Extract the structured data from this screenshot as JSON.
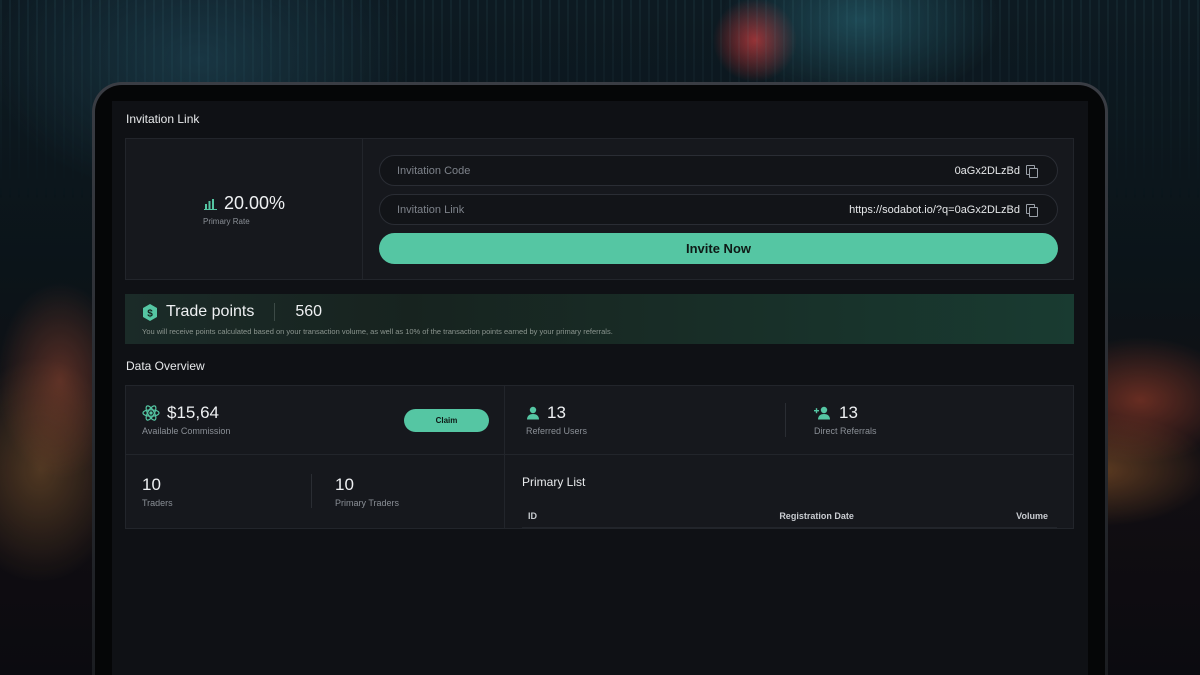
{
  "colors": {
    "accent": "#55c6a3",
    "panel": "#16181d",
    "screen": "#0f1115"
  },
  "invitation": {
    "section_title": "Invitation Link",
    "rate_icon": "bar-chart-icon",
    "rate_value": "20.00%",
    "rate_label": "Primary Rate",
    "code_label": "Invitation Code",
    "code_value": "0aGx2DLzBd",
    "link_label": "Invitation Link",
    "link_value": "https://sodabot.io/?q=0aGx2DLzBd",
    "copy_icon": "copy-icon",
    "invite_button": "Invite Now"
  },
  "trade_points": {
    "icon": "dollar-coin-icon",
    "title": "Trade points",
    "value": "560",
    "note": "You will receive points calculated based on your transaction volume, as well as 10% of the transaction points earned by your primary referrals."
  },
  "overview": {
    "section_title": "Data Overview",
    "commission": {
      "icon": "atom-icon",
      "value": "$15,64",
      "label": "Available Commission",
      "claim_button": "Claim"
    },
    "referred_users": {
      "icon": "user-icon",
      "value": "13",
      "label": "Referred Users"
    },
    "direct_referrals": {
      "icon": "user-add-icon",
      "value": "13",
      "label": "Direct Referrals"
    },
    "traders": {
      "value": "10",
      "label": "Traders"
    },
    "primary_traders": {
      "value": "10",
      "label": "Primary Traders"
    },
    "primary_list": {
      "title": "Primary List",
      "columns": [
        "ID",
        "Registration Date",
        "Volume"
      ]
    }
  }
}
